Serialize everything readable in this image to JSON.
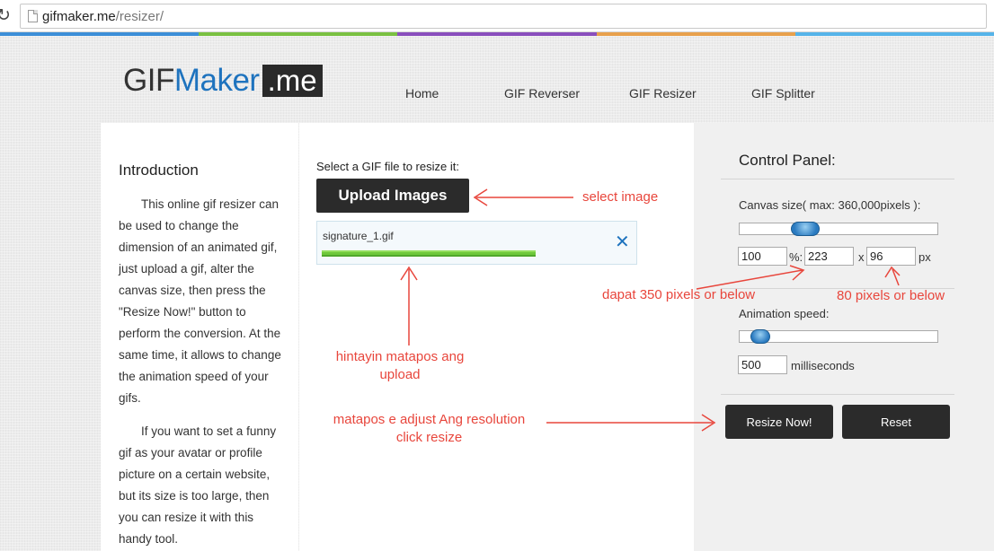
{
  "browser": {
    "url_domain": "gifmaker.me",
    "url_path": "/resizer/",
    "rainbow_colors": [
      "#3d8fd8",
      "#7ac142",
      "#8a4fbd",
      "#e8a14d",
      "#56b4e9"
    ]
  },
  "header": {
    "logo_part1": "GIF",
    "logo_part2": "Maker",
    "logo_part3": ".me",
    "nav": [
      "Home",
      "GIF Reverser",
      "GIF Resizer",
      "GIF Splitter"
    ]
  },
  "intro": {
    "title": "Introduction",
    "p1": "This online gif resizer can be used to change the dimension of an animated gif, just upload a gif, alter the canvas size, then press the \"Resize Now!\" button to perform the conversion. At the same time, it allows to change the animation speed of your gifs.",
    "p2": "If you want to set a funny gif as your avatar or profile picture on a certain website, but its size is too large, then you can resize it with this handy tool."
  },
  "upload": {
    "label": "Select a GIF file to resize it:",
    "button": "Upload Images",
    "file_name": "signature_1.gif",
    "file_progress": 1.0
  },
  "control_panel": {
    "title": "Control Panel:",
    "canvas_label": "Canvas size( max: 360,000pixels ):",
    "canvas_slider": 0.3,
    "percent_value": "100",
    "percent_sign": "%:",
    "width_value": "223",
    "times": "x",
    "height_value": "96",
    "px": "px",
    "speed_label": "Animation speed:",
    "speed_slider": 0.06,
    "speed_value": "500",
    "speed_unit": "milliseconds",
    "resize_button": "Resize Now!",
    "reset_button": "Reset"
  },
  "annotations": {
    "select": "select image",
    "width_note": "dapat 350 pixels or below",
    "height_note": "80 pixels or below",
    "wait_line1": "hintayin matapos ang",
    "wait_line2": "upload",
    "resize_line1": "matapos e adjust Ang resolution",
    "resize_line2": "click resize",
    "color": "#e8463c"
  }
}
